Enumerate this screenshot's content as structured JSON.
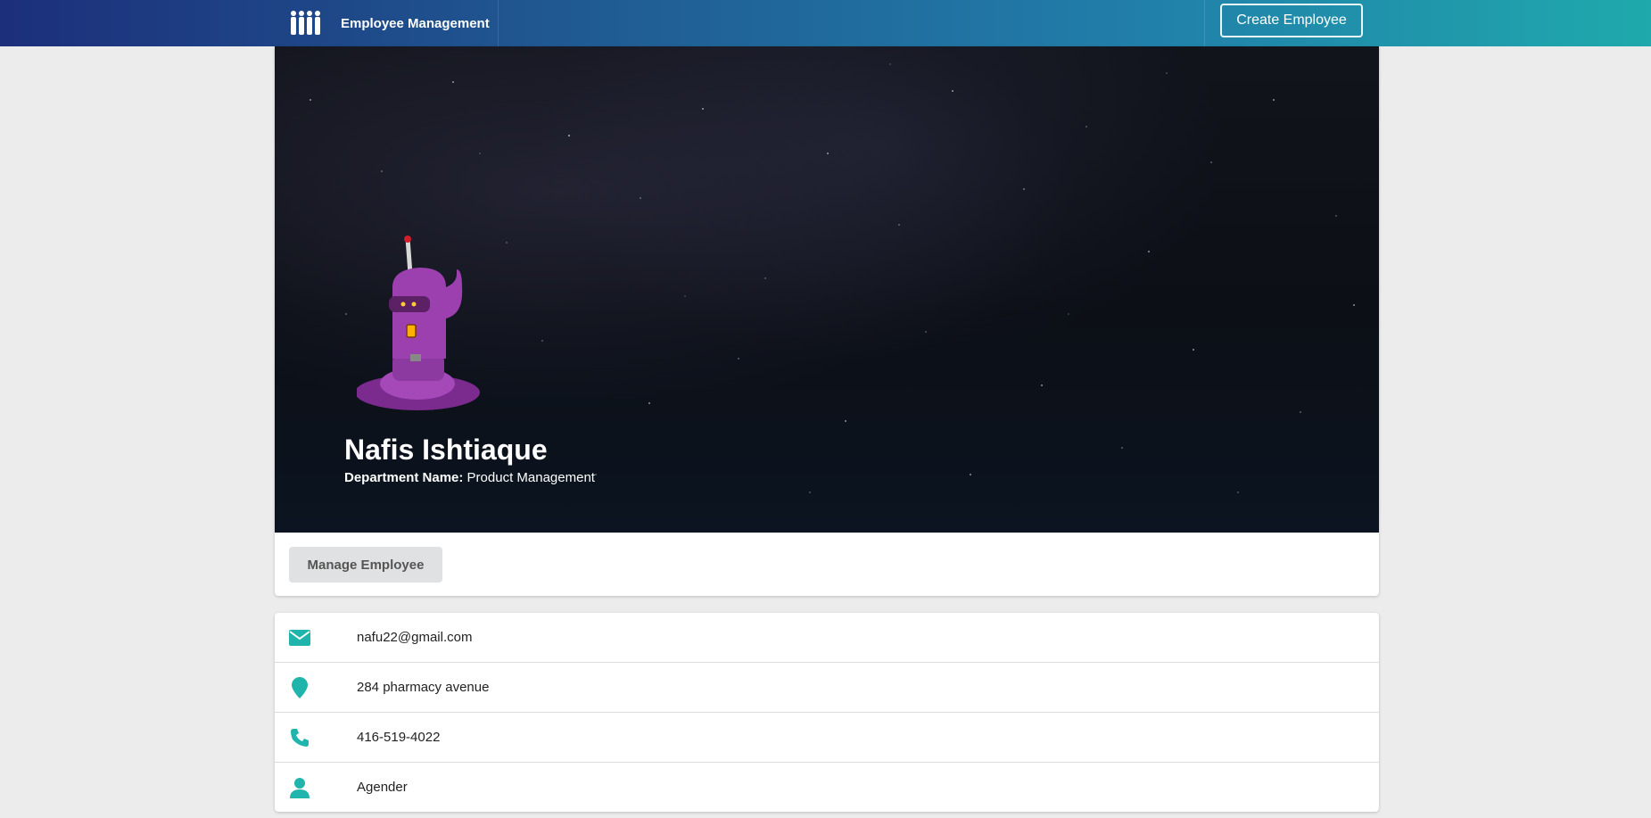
{
  "header": {
    "app_title": "Employee Management",
    "logo_icon": "people-group-icon",
    "create_label": "Create Employee"
  },
  "profile": {
    "name": "Nafis Ishtiaque",
    "department_label": "Department Name:",
    "department_value": "Product Management",
    "avatar_icon": "purple-robot-avatar",
    "manage_label": "Manage Employee"
  },
  "details": {
    "email": "nafu22@gmail.com",
    "address": "284 pharmacy avenue",
    "phone": "416-519-4022",
    "gender": "Agender"
  },
  "colors": {
    "accent": "#1fb5ad",
    "header_start": "#1c2f7a",
    "header_end": "#1fa9ac"
  }
}
